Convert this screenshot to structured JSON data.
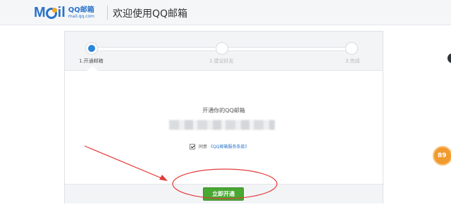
{
  "header": {
    "logo_m": "M",
    "logo_il": "il",
    "logo_cn": "QQ邮箱",
    "logo_url": "mail.qq.com",
    "welcome": "欢迎使用QQ邮箱"
  },
  "steps": [
    {
      "label": "1.开通邮箱",
      "active": true
    },
    {
      "label": "2.建议好友",
      "active": false
    },
    {
      "label": "3.完成",
      "active": false
    }
  ],
  "main": {
    "title": "开通你的QQ邮箱",
    "agree_prefix": "同意",
    "agree_link": "《QQ邮箱服务条款》",
    "agree_checked": true
  },
  "footer": {
    "open_button": "立即开通"
  },
  "side": {
    "badge_text": "89"
  },
  "colors": {
    "accent": "#2a73c8",
    "button": "#48a832",
    "annotation": "#e23b3b"
  }
}
